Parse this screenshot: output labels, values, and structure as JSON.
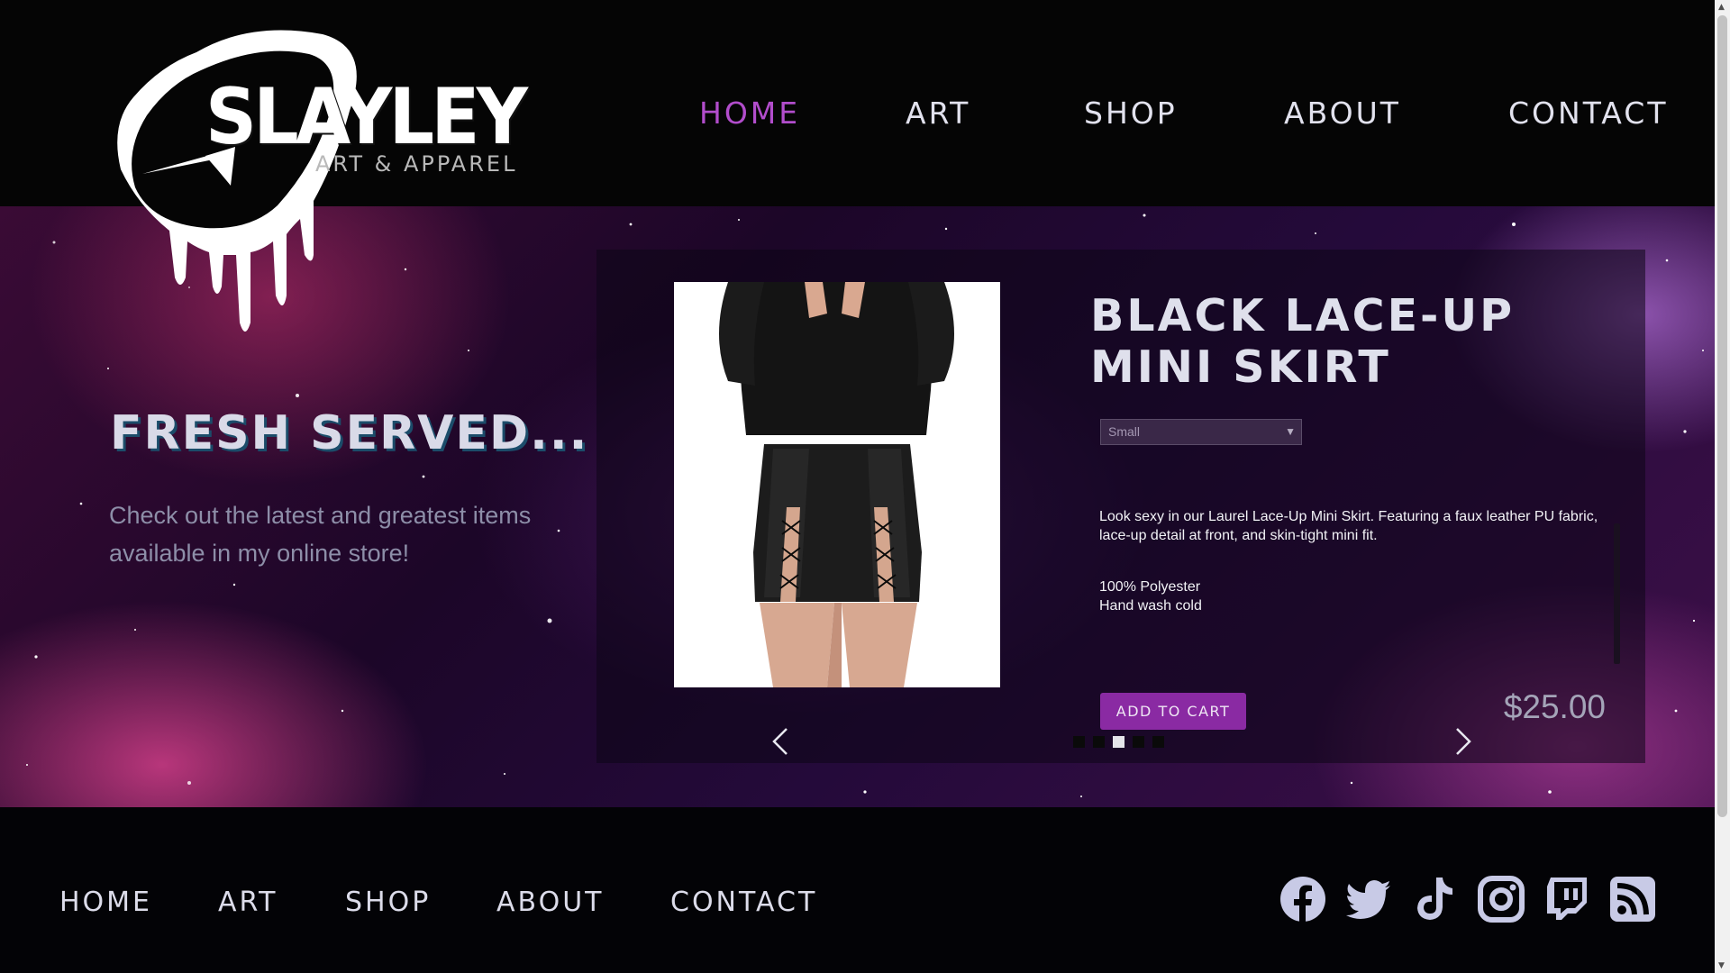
{
  "brand": {
    "name": "SLAYLEY",
    "tagline": "ART & APPAREL"
  },
  "nav": {
    "items": [
      {
        "label": "HOME",
        "active": true
      },
      {
        "label": "ART",
        "active": false
      },
      {
        "label": "SHOP",
        "active": false
      },
      {
        "label": "ABOUT",
        "active": false
      },
      {
        "label": "CONTACT",
        "active": false
      }
    ]
  },
  "hero": {
    "title": "FRESH SERVED...",
    "text": "Check out the latest and greatest items available in my online store!"
  },
  "product": {
    "title": "BLACK LACE-UP MINI SKIRT",
    "size_selected": "Small",
    "description": "Look sexy in our Laurel Lace-Up Mini Skirt. Featuring a faux leather PU fabric, lace-up detail at front, and skin-tight mini fit.",
    "material": "100% Polyester",
    "care": "Hand wash cold",
    "add_to_cart_label": "ADD TO CART",
    "price": "$25.00"
  },
  "carousel": {
    "slide_count": 5,
    "active_index": 2
  },
  "footer": {
    "nav": [
      "HOME",
      "ART",
      "SHOP",
      "ABOUT",
      "CONTACT"
    ],
    "social": [
      "facebook-icon",
      "twitter-icon",
      "tiktok-icon",
      "instagram-icon",
      "twitch-icon",
      "rss-icon"
    ]
  },
  "colors": {
    "accent": "#b24dcc",
    "button": "#8a2aa3",
    "nav_text": "#e2e2ee",
    "background": "#050505"
  }
}
